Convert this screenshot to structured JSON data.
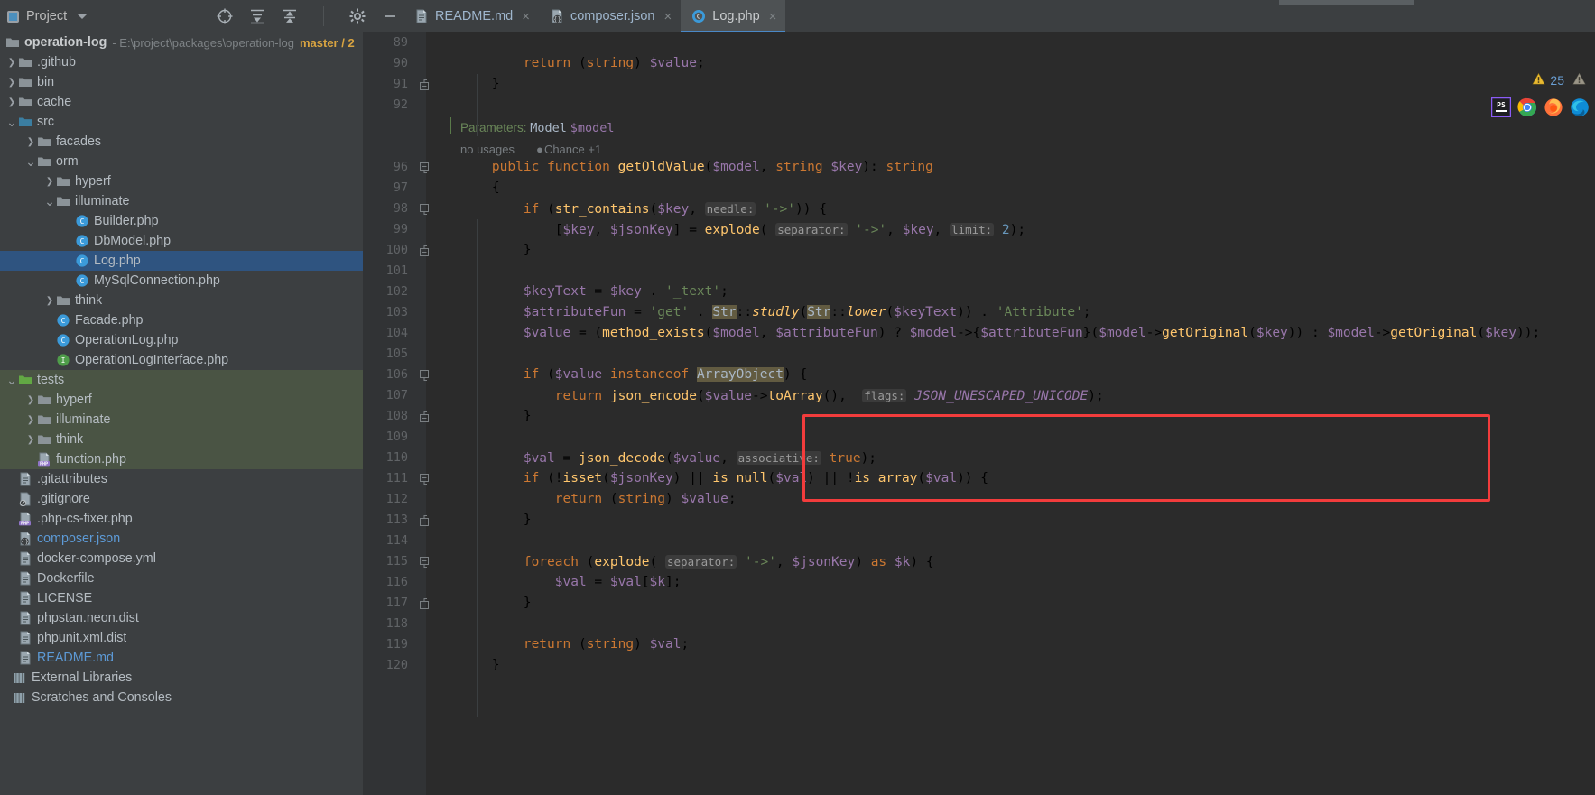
{
  "toolbar": {
    "project_label": "Project",
    "icons": [
      "locate-icon",
      "expand-all-icon",
      "collapse-all-icon",
      "gear-icon",
      "minimize-icon"
    ]
  },
  "tabs": [
    {
      "label": "README.md",
      "icon": "markdown-file-icon",
      "active": false,
      "close": "×"
    },
    {
      "label": "composer.json",
      "icon": "json-file-icon",
      "active": false,
      "close": "×"
    },
    {
      "label": "Log.php",
      "icon": "php-class-icon",
      "active": true,
      "close": "×"
    }
  ],
  "inspection": {
    "warning_count": "25"
  },
  "project": {
    "name": "operation-log",
    "path": "- E:\\project\\packages\\operation-log",
    "branch": "master / 2"
  },
  "tree": [
    {
      "label": ".github",
      "indent": 0,
      "arrow": "›",
      "kind": "folder",
      "state": ""
    },
    {
      "label": "bin",
      "indent": 0,
      "arrow": "›",
      "kind": "folder",
      "state": ""
    },
    {
      "label": "cache",
      "indent": 0,
      "arrow": "›",
      "kind": "folder",
      "state": ""
    },
    {
      "label": "src",
      "indent": 0,
      "arrow": "⌄",
      "kind": "source",
      "state": ""
    },
    {
      "label": "facades",
      "indent": 1,
      "arrow": "›",
      "kind": "folder",
      "state": ""
    },
    {
      "label": "orm",
      "indent": 1,
      "arrow": "⌄",
      "kind": "folder",
      "state": ""
    },
    {
      "label": "hyperf",
      "indent": 2,
      "arrow": "›",
      "kind": "folder",
      "state": ""
    },
    {
      "label": "illuminate",
      "indent": 2,
      "arrow": "⌄",
      "kind": "folder",
      "state": ""
    },
    {
      "label": "Builder.php",
      "indent": 3,
      "arrow": "",
      "kind": "class",
      "state": ""
    },
    {
      "label": "DbModel.php",
      "indent": 3,
      "arrow": "",
      "kind": "class",
      "state": ""
    },
    {
      "label": "Log.php",
      "indent": 3,
      "arrow": "",
      "kind": "class",
      "state": "selected"
    },
    {
      "label": "MySqlConnection.php",
      "indent": 3,
      "arrow": "",
      "kind": "class",
      "state": ""
    },
    {
      "label": "think",
      "indent": 2,
      "arrow": "›",
      "kind": "folder",
      "state": ""
    },
    {
      "label": "Facade.php",
      "indent": 2,
      "arrow": "",
      "kind": "class",
      "state": ""
    },
    {
      "label": "OperationLog.php",
      "indent": 2,
      "arrow": "",
      "kind": "class",
      "state": ""
    },
    {
      "label": "OperationLogInterface.php",
      "indent": 2,
      "arrow": "",
      "kind": "iface",
      "state": ""
    },
    {
      "label": "tests",
      "indent": 0,
      "arrow": "⌄",
      "kind": "tests",
      "state": "green"
    },
    {
      "label": "hyperf",
      "indent": 1,
      "arrow": "›",
      "kind": "folder",
      "state": "green"
    },
    {
      "label": "illuminate",
      "indent": 1,
      "arrow": "›",
      "kind": "folder",
      "state": "green"
    },
    {
      "label": "think",
      "indent": 1,
      "arrow": "›",
      "kind": "folder",
      "state": "green"
    },
    {
      "label": "function.php",
      "indent": 1,
      "arrow": "",
      "kind": "php",
      "state": "green"
    },
    {
      "label": ".gitattributes",
      "indent": 0,
      "arrow": "",
      "kind": "file",
      "state": ""
    },
    {
      "label": ".gitignore",
      "indent": 0,
      "arrow": "",
      "kind": "gitignore",
      "state": ""
    },
    {
      "label": ".php-cs-fixer.php",
      "indent": 0,
      "arrow": "",
      "kind": "php",
      "state": ""
    },
    {
      "label": "composer.json",
      "indent": 0,
      "arrow": "",
      "kind": "json",
      "state": "blue"
    },
    {
      "label": "docker-compose.yml",
      "indent": 0,
      "arrow": "",
      "kind": "file",
      "state": ""
    },
    {
      "label": "Dockerfile",
      "indent": 0,
      "arrow": "",
      "kind": "file",
      "state": ""
    },
    {
      "label": "LICENSE",
      "indent": 0,
      "arrow": "",
      "kind": "file",
      "state": ""
    },
    {
      "label": "phpstan.neon.dist",
      "indent": 0,
      "arrow": "",
      "kind": "file",
      "state": ""
    },
    {
      "label": "phpunit.xml.dist",
      "indent": 0,
      "arrow": "",
      "kind": "file",
      "state": ""
    },
    {
      "label": "README.md",
      "indent": 0,
      "arrow": "",
      "kind": "md",
      "state": "blue"
    },
    {
      "label": "External Libraries",
      "indent": -1,
      "arrow": "",
      "kind": "lib",
      "state": ""
    },
    {
      "label": "Scratches and Consoles",
      "indent": -1,
      "arrow": "",
      "kind": "lib",
      "state": ""
    }
  ],
  "editor": {
    "file": "Log.php",
    "gutter_param_hint": "Parameters:",
    "gutter_param_type": "Model",
    "gutter_param_name": "$model",
    "usages_text": "no usages",
    "author_text": "Chance +1",
    "first_visible_line": 89,
    "lines": [
      {
        "n": "89",
        "fold": "",
        "text": ""
      },
      {
        "n": "90",
        "fold": "",
        "text": "        return (string) $value;"
      },
      {
        "n": "91",
        "fold": "end",
        "text": "    }"
      },
      {
        "n": "92",
        "fold": "",
        "text": ""
      },
      {
        "n": "",
        "fold": "",
        "text": "__PARAMHINT__"
      },
      {
        "n": "",
        "fold": "",
        "text": "__USAGES__"
      },
      {
        "n": "96",
        "fold": "start",
        "text": "    public function getOldValue($model, string $key): string"
      },
      {
        "n": "97",
        "fold": "",
        "text": "    {"
      },
      {
        "n": "98",
        "fold": "start",
        "text": "        if (str_contains($key, needle: '->')) {"
      },
      {
        "n": "99",
        "fold": "",
        "text": "            [$key, $jsonKey] = explode( separator: '->', $key, limit: 2);"
      },
      {
        "n": "100",
        "fold": "end",
        "text": "        }"
      },
      {
        "n": "101",
        "fold": "",
        "text": ""
      },
      {
        "n": "102",
        "fold": "",
        "text": "        $keyText = $key . '_text';"
      },
      {
        "n": "103",
        "fold": "",
        "text": "        $attributeFun = 'get' . Str::studly(Str::lower($keyText)) . 'Attribute';"
      },
      {
        "n": "104",
        "fold": "",
        "text": "        $value = (method_exists($model, $attributeFun) ? $model->{$attributeFun}($model->getOriginal($key)) : $model->getOriginal($key));"
      },
      {
        "n": "105",
        "fold": "",
        "text": ""
      },
      {
        "n": "106",
        "fold": "start",
        "text": "        if ($value instanceof ArrayObject) {"
      },
      {
        "n": "107",
        "fold": "",
        "text": "            return json_encode($value->toArray(),  flags: JSON_UNESCAPED_UNICODE);"
      },
      {
        "n": "108",
        "fold": "end",
        "text": "        }"
      },
      {
        "n": "109",
        "fold": "",
        "text": ""
      },
      {
        "n": "110",
        "fold": "",
        "text": "        $val = json_decode($value, associative: true);"
      },
      {
        "n": "111",
        "fold": "start",
        "text": "        if (!isset($jsonKey) || is_null($val) || !is_array($val)) {"
      },
      {
        "n": "112",
        "fold": "",
        "text": "            return (string) $value;"
      },
      {
        "n": "113",
        "fold": "end",
        "text": "        }"
      },
      {
        "n": "114",
        "fold": "",
        "text": ""
      },
      {
        "n": "115",
        "fold": "start",
        "text": "        foreach (explode( separator: '->', $jsonKey) as $k) {"
      },
      {
        "n": "116",
        "fold": "",
        "text": "            $val = $val[$k];"
      },
      {
        "n": "117",
        "fold": "end",
        "text": "        }"
      },
      {
        "n": "118",
        "fold": "",
        "text": ""
      },
      {
        "n": "119",
        "fold": "",
        "text": "        return (string) $val;"
      },
      {
        "n": "120",
        "fold": "",
        "text": "    }"
      }
    ],
    "annotation": {
      "name": "red-highlight-box",
      "color": "#f23c3c",
      "covers_lines": "105-109"
    }
  },
  "taskbar": {
    "icons": [
      "phpstorm-icon",
      "chrome-icon",
      "firefox-icon",
      "edge-icon"
    ]
  },
  "colors": {
    "accent": "#4a88c7",
    "selection": "#2f5480",
    "green_selection": "#4a5444",
    "editor_bg": "#2b2b2b",
    "panel_bg": "#3c3f41",
    "warning": "#e8b931",
    "annotation": "#f23c3c"
  }
}
